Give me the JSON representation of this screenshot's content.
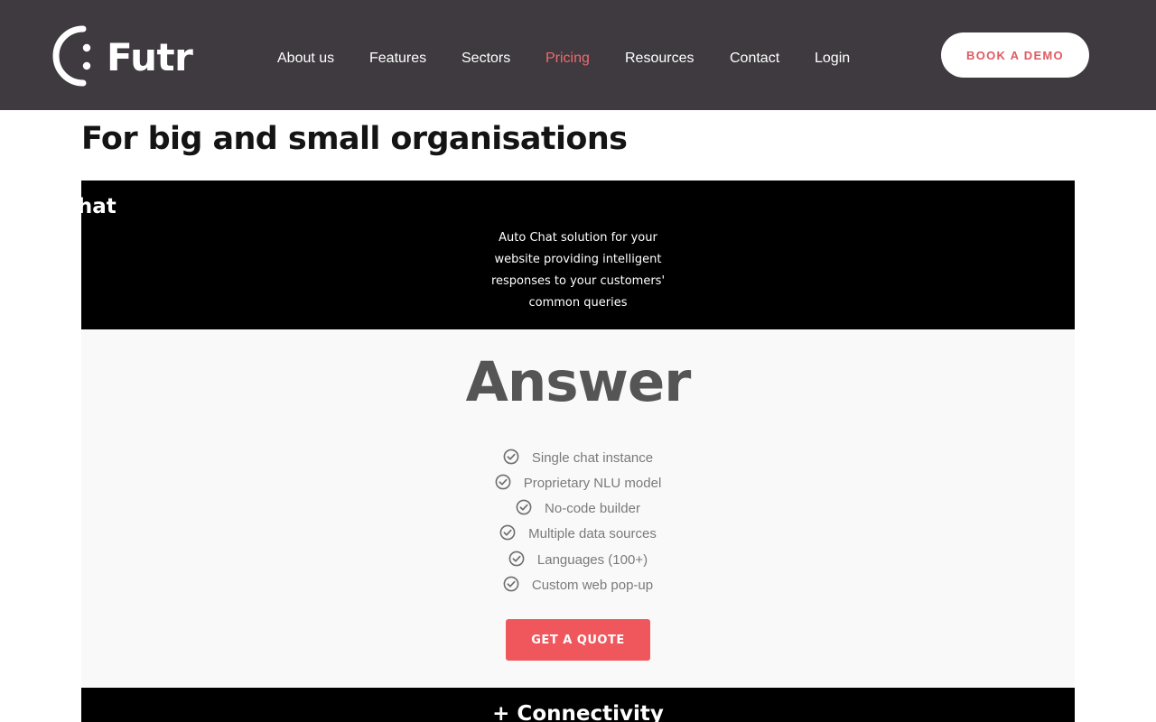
{
  "header": {
    "brand": "Futr",
    "nav": [
      {
        "label": "About us",
        "active": false
      },
      {
        "label": "Features",
        "active": false
      },
      {
        "label": "Sectors",
        "active": false
      },
      {
        "label": "Pricing",
        "active": true
      },
      {
        "label": "Resources",
        "active": false
      },
      {
        "label": "Contact",
        "active": false
      },
      {
        "label": "Login",
        "active": false
      }
    ],
    "demo_button": "BOOK A DEMO"
  },
  "main": {
    "title": "For big and small organisations",
    "plan": {
      "name": "Auto Chat",
      "description": "Auto Chat solution for your website providing intelligent responses to your customers' common queries",
      "tier": "Answer",
      "features": [
        "Single chat instance",
        "Proprietary NLU model",
        "No-code builder",
        "Multiple data sources",
        "Languages (100+)",
        "Custom web pop-up"
      ],
      "cta": "GET A QUOTE"
    },
    "next_plan": {
      "name": "+ Connectivity"
    }
  },
  "icons": {
    "feature": "check-circle-icon"
  },
  "colors": {
    "header_bg": "#3e3a3f",
    "accent": "#ef575d",
    "active_nav": "#ee6a6e",
    "plan_header_bg": "#000000",
    "plan_body_bg": "#f9f9f9"
  }
}
